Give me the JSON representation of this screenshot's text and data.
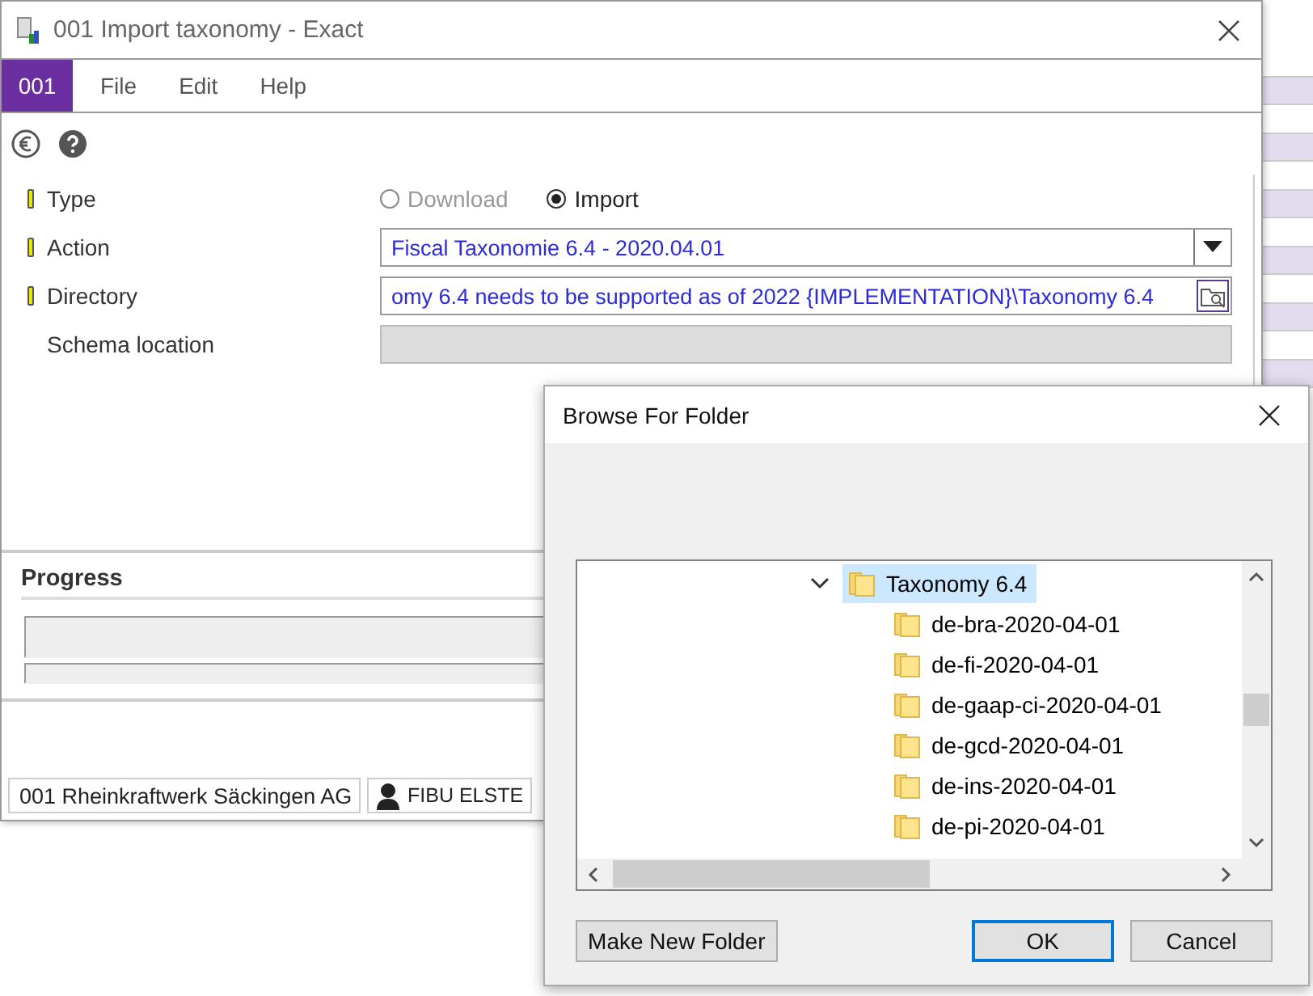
{
  "window": {
    "title": "001 Import taxonomy - Exact",
    "company_code": "001",
    "menu": [
      "File",
      "Edit",
      "Help"
    ]
  },
  "form": {
    "rows": [
      {
        "label": "Type",
        "required": true,
        "kind": "radio",
        "options": [
          {
            "label": "Download",
            "selected": false,
            "disabled": true
          },
          {
            "label": "Import",
            "selected": true,
            "disabled": false
          }
        ]
      },
      {
        "label": "Action",
        "required": true,
        "kind": "dropdown",
        "value": "Fiscal Taxonomie 6.4 - 2020.04.01"
      },
      {
        "label": "Directory",
        "required": true,
        "kind": "browse",
        "value": "omy 6.4 needs to be supported as of 2022 {IMPLEMENTATION}\\Taxonomy 6.4"
      },
      {
        "label": "Schema location",
        "required": false,
        "kind": "readonly"
      }
    ]
  },
  "progress": {
    "title": "Progress"
  },
  "status_bar": [
    "001 Rheinkraftwerk Säckingen AG",
    "FIBU ELSTE"
  ],
  "dialog": {
    "title": "Browse For Folder",
    "tree": [
      {
        "label": "Taxonomy 6.4",
        "expanded": true,
        "selected": true,
        "children": [
          {
            "label": "de-bra-2020-04-01",
            "selected": false
          },
          {
            "label": "de-fi-2020-04-01",
            "selected": false
          },
          {
            "label": "de-gaap-ci-2020-04-01",
            "selected": false
          },
          {
            "label": "de-gcd-2020-04-01",
            "selected": false
          },
          {
            "label": "de-ins-2020-04-01",
            "selected": false
          },
          {
            "label": "de-pi-2020-04-01",
            "selected": false
          }
        ]
      }
    ],
    "buttons": [
      {
        "label": "Make New Folder",
        "default": false
      },
      {
        "label": "OK",
        "default": true
      },
      {
        "label": "Cancel",
        "default": false
      }
    ]
  }
}
